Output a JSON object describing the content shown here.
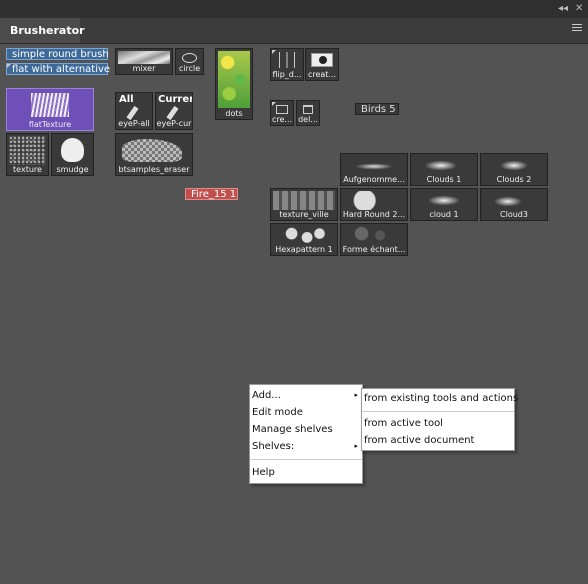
{
  "window": {
    "collapse_glyph": "◂◂",
    "close_glyph": "✕"
  },
  "panel": {
    "tab_label": "Brusherator",
    "menu_icon": "hamburger-menu-icon"
  },
  "text_buttons": {
    "simple_round": "simple round brush",
    "flat_alt": "flat with alternative",
    "birds": "Birds 5",
    "fire": "Fire_15 1"
  },
  "brushes": {
    "mixer": "mixer",
    "circle": "circle",
    "dots": "dots",
    "flip": "flip_d...",
    "create": "creat...",
    "flat_texture": "flatTexture",
    "eyep_all": "eyeP-all",
    "eyep_all_top": "All",
    "eyep_cur": "eyeP-cur",
    "eyep_cur_top": "Current",
    "cre": "cre...",
    "del": "del...",
    "texture": "texture",
    "smudge": "smudge",
    "bt_eraser": "btsamples_eraser",
    "aufgenommen": "Aufgenomme...",
    "clouds1": "Clouds 1",
    "clouds2": "Clouds 2",
    "texture_ville": "texture_ville",
    "hard_round": "Hard Round 2...",
    "cloud1": "cloud 1",
    "cloud3": "Cloud3",
    "hexapattern": "Hexapattern 1",
    "forme": "Forme échant..."
  },
  "context_menu": {
    "items": [
      "Add...",
      "Edit mode",
      "Manage shelves",
      "Shelves:",
      "Help"
    ]
  },
  "submenu": {
    "items": [
      "from existing tools and actions",
      "from active tool",
      "from active document"
    ]
  },
  "colors": {
    "panel_bg": "#535353",
    "selected_blue": "#3e6a9a",
    "purple": "#6f4fb8",
    "fire_red": "#c0504d"
  }
}
